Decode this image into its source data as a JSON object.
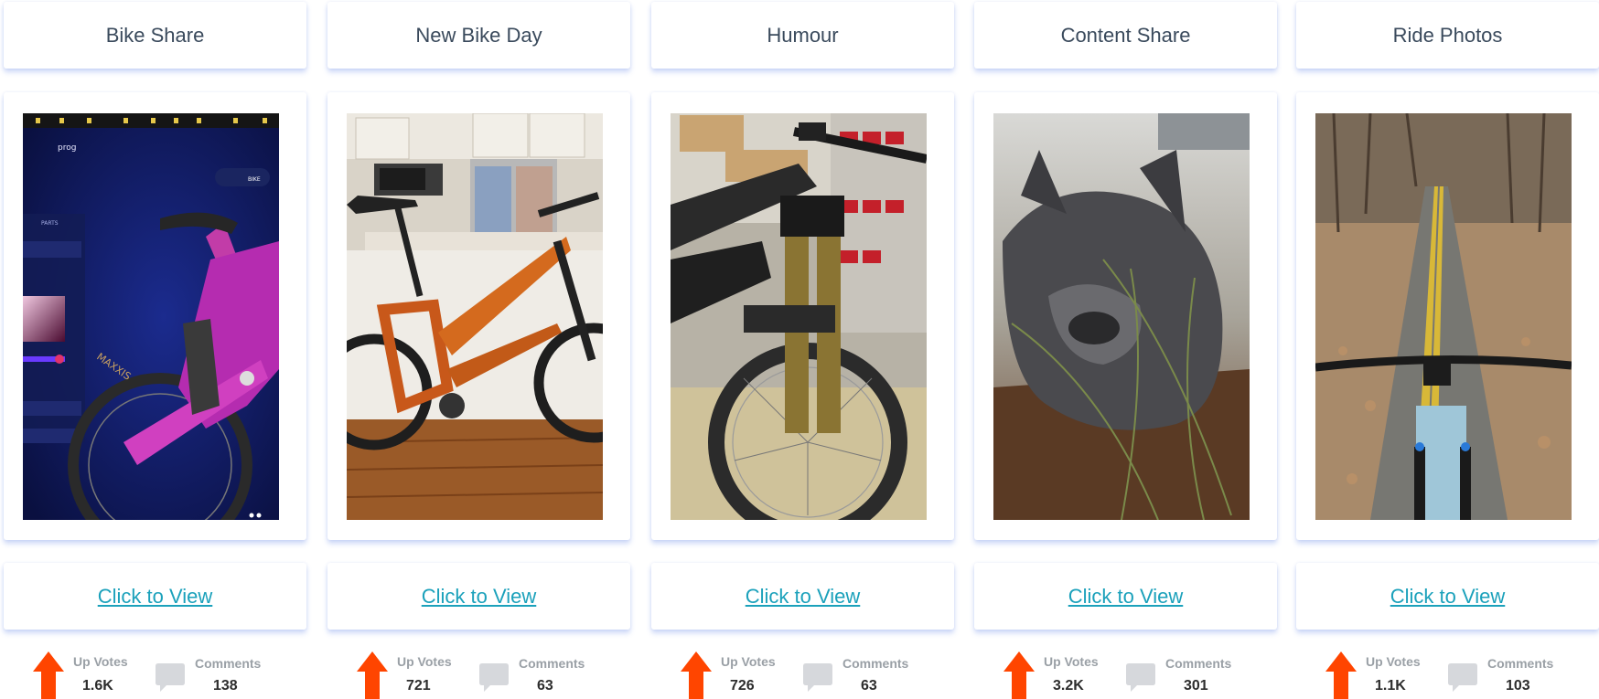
{
  "link_label": "Click to View",
  "labels": {
    "up_votes": "Up Votes",
    "comments": "Comments"
  },
  "colors": {
    "accent": "#1ba1bb",
    "upvote": "#ff4500",
    "title": "#3a4a5c"
  },
  "cards": [
    {
      "category": "Bike Share",
      "upvotes": "1.6K",
      "comments": "138",
      "photo": "purple bike in configurator app",
      "overlay": {
        "tab_left": "prog",
        "tab_right": "BIKE",
        "panel": "PARTS",
        "tire": "MAXXIS"
      }
    },
    {
      "category": "New Bike Day",
      "upvotes": "721",
      "comments": "63",
      "photo": "orange bike in kitchen"
    },
    {
      "category": "Humour",
      "upvotes": "726",
      "comments": "63",
      "photo": "black bike front fork in shop"
    },
    {
      "category": "Content Share",
      "upvotes": "3.2K",
      "comments": "301",
      "photo": "grey french bulldog sniffing plants"
    },
    {
      "category": "Ride Photos",
      "upvotes": "1.1K",
      "comments": "103",
      "photo": "handlebar view of leafy trail"
    }
  ]
}
